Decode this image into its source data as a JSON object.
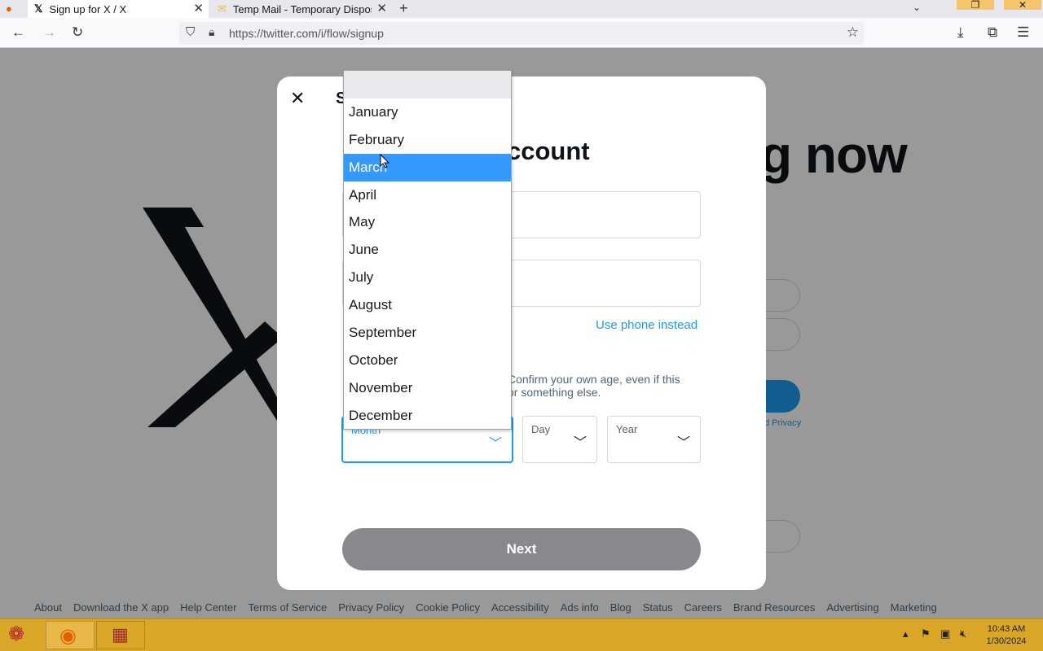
{
  "browser": {
    "tabs": [
      {
        "title": "Sign up for X / X",
        "icon": "x-favicon-icon"
      },
      {
        "title": "Temp Mail - Temporary Disposal",
        "icon": "temp-mail-favicon-icon"
      }
    ],
    "url": "https://twitter.com/i/flow/signup"
  },
  "background": {
    "headline": "ning now",
    "privacy_fragment": "d Privacy",
    "footer": [
      "About",
      "Download the X app",
      "Help Center",
      "Terms of Service",
      "Privacy Policy",
      "Cookie Policy",
      "Accessibility",
      "Ads info",
      "Blog",
      "Status",
      "Careers",
      "Brand Resources",
      "Advertising",
      "Marketing"
    ]
  },
  "modal": {
    "step": "S",
    "title": "ccount",
    "use_phone": "Use phone instead",
    "dob_text_line1": "Confirm your own age, even if this",
    "dob_text_line2": "or something else.",
    "month_label": "Month",
    "day_label": "Day",
    "year_label": "Year",
    "next": "Next"
  },
  "month_dropdown": {
    "options": [
      "January",
      "February",
      "March",
      "April",
      "May",
      "June",
      "July",
      "August",
      "September",
      "October",
      "November",
      "December"
    ],
    "highlighted": "March"
  },
  "taskbar": {
    "time": "10:43 AM",
    "date": "1/30/2024"
  },
  "colors": {
    "accent": "#1d9bf0",
    "dropdown_highlight": "#3399ff",
    "taskbar": "#d9a627"
  }
}
